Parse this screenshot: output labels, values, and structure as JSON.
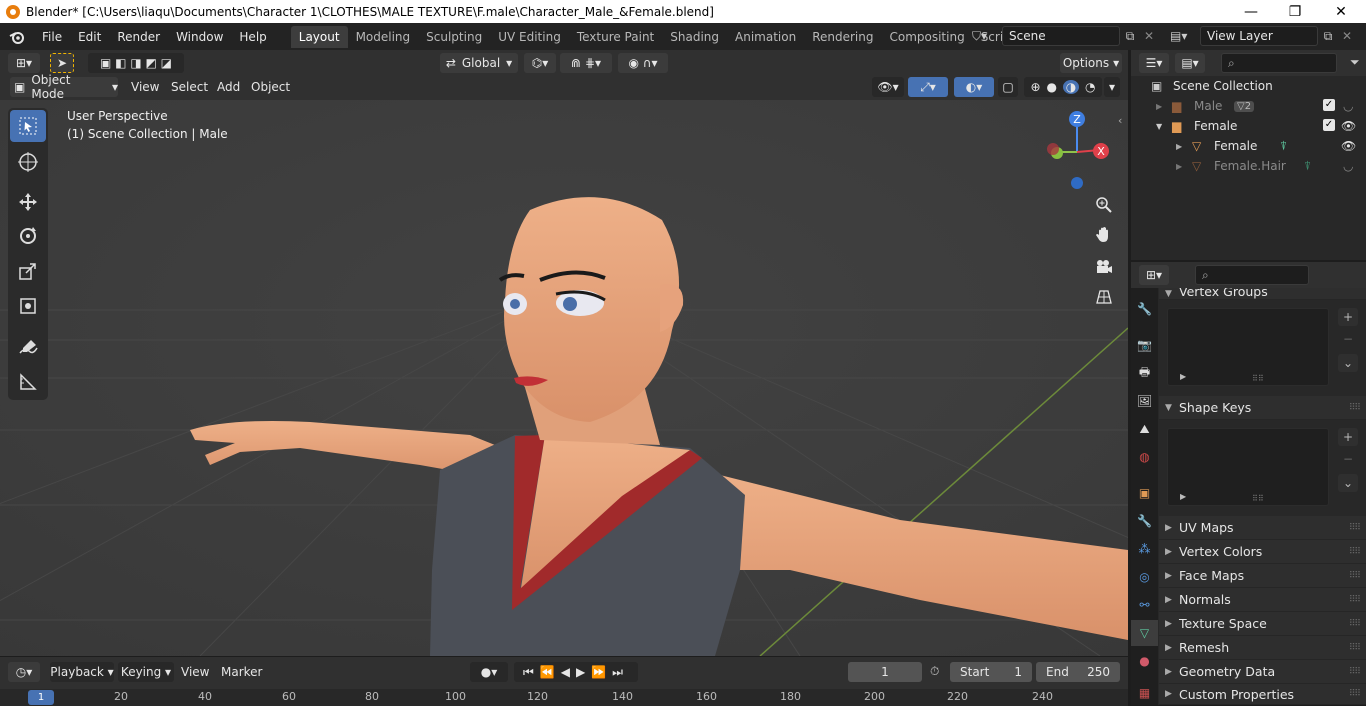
{
  "window": {
    "title": "Blender* [C:\\Users\\liaqu\\Documents\\Character 1\\CLOTHES\\MALE TEXTURE\\F.male\\Character_Male_&Female.blend]",
    "minimize": "—",
    "maximize": "❐",
    "close": "✕"
  },
  "menubar": {
    "items": [
      "File",
      "Edit",
      "Render",
      "Window",
      "Help"
    ],
    "workspaces": [
      "Layout",
      "Modeling",
      "Sculpting",
      "UV Editing",
      "Texture Paint",
      "Shading",
      "Animation",
      "Rendering",
      "Compositing",
      "Scripting"
    ],
    "add_workspace": "+",
    "scene": "Scene",
    "view_layer": "View Layer"
  },
  "viewport_header": {
    "orientation": "Global",
    "options": "Options",
    "mode": "Object Mode",
    "menus": [
      "View",
      "Select",
      "Add",
      "Object"
    ]
  },
  "viewport": {
    "perspective": "User Perspective",
    "collection": "(1) Scene Collection | Male",
    "gizmo": {
      "z": "Z",
      "x": "X"
    }
  },
  "timeline": {
    "menus": [
      "Playback",
      "Keying",
      "View",
      "Marker"
    ],
    "current_frame": "1",
    "start_label": "Start",
    "start": "1",
    "end_label": "End",
    "end": "250",
    "ruler": [
      "1",
      "20",
      "40",
      "60",
      "80",
      "100",
      "120",
      "140",
      "160",
      "180",
      "200",
      "220",
      "240"
    ]
  },
  "outliner": {
    "root": "Scene Collection",
    "items": [
      {
        "label": "Male",
        "badge": "2",
        "dim": true
      },
      {
        "label": "Female",
        "dim": false
      },
      {
        "label": "Female",
        "dim": false
      },
      {
        "label": "Female.Hair",
        "dim": true
      }
    ]
  },
  "properties": {
    "sections": [
      "Vertex Groups",
      "Shape Keys",
      "UV Maps",
      "Vertex Colors",
      "Face Maps",
      "Normals",
      "Texture Space",
      "Remesh",
      "Geometry Data",
      "Custom Properties"
    ],
    "add": "+",
    "remove": "−"
  },
  "colors": {
    "accent": "#4772b3",
    "header": "#303030",
    "viewport": "#3d3d3d",
    "skin": "#e9a57a",
    "shirt": "#4b4f57",
    "trim": "#a12a2b"
  }
}
